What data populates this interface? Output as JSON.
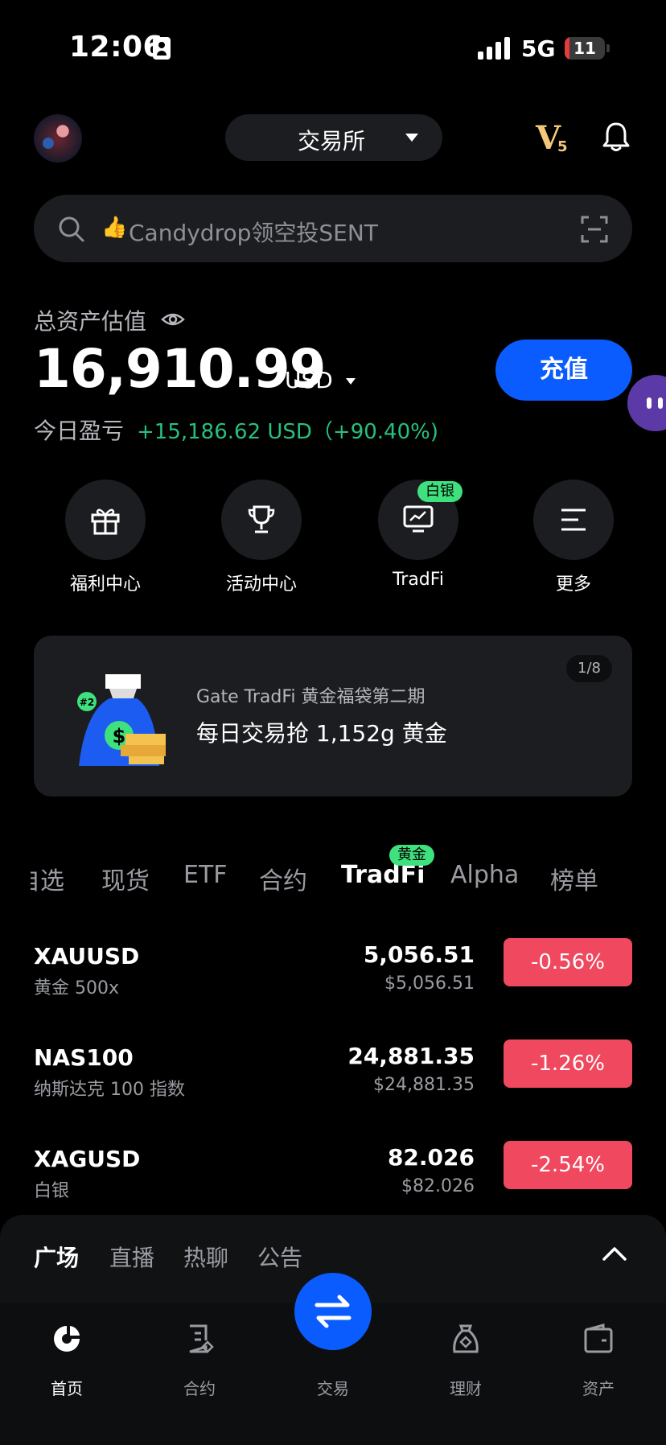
{
  "status_bar": {
    "time": "12:06",
    "network": "5G",
    "battery": "11",
    "battery_level": 0.11
  },
  "header": {
    "exchange_label": "交易所",
    "vip_letter": "V",
    "vip_level": "5"
  },
  "search": {
    "text": "Candydrop领空投SENT"
  },
  "assets": {
    "label": "总资产估值",
    "value": "16,910.99",
    "currency": "USD",
    "pnl_label": "今日盈亏",
    "pnl_value": "+15,186.62 USD（+90.40%)",
    "deposit_label": "充值"
  },
  "quick_actions": [
    {
      "label": "福利中心",
      "icon": "gift-icon"
    },
    {
      "label": "活动中心",
      "icon": "trophy-icon"
    },
    {
      "label": "TradFi",
      "icon": "chart-monitor-icon",
      "badge": "白银"
    },
    {
      "label": "更多",
      "icon": "menu-icon"
    }
  ],
  "banner": {
    "page": "1/8",
    "title": "Gate TradFi 黄金福袋第二期",
    "subtitle": "每日交易抢 1,152g 黄金",
    "art_tag": "#2"
  },
  "market_tabs": {
    "items": [
      "自选",
      "现货",
      "ETF",
      "合约",
      "TradFi",
      "Alpha",
      "榜单"
    ],
    "active": "TradFi",
    "badge": "黄金"
  },
  "market_rows": [
    {
      "symbol": "XAUUSD",
      "name": "黄金 500x",
      "price": "5,056.51",
      "price_usd": "$5,056.51",
      "change": "-0.56%"
    },
    {
      "symbol": "NAS100",
      "name": "纳斯达克 100 指数",
      "price": "24,881.35",
      "price_usd": "$24,881.35",
      "change": "-1.26%"
    },
    {
      "symbol": "XAGUSD",
      "name": "白银",
      "price": "82.026",
      "price_usd": "$82.026",
      "change": "-2.54%"
    }
  ],
  "feed_tabs": {
    "items": [
      "广场",
      "直播",
      "热聊",
      "公告"
    ],
    "active": "广场"
  },
  "bottom_nav": {
    "items": [
      {
        "label": "首页",
        "icon": "home-icon",
        "active": true
      },
      {
        "label": "合约",
        "icon": "contract-icon",
        "active": false
      },
      {
        "label": "交易",
        "icon": "swap-icon",
        "active": false
      },
      {
        "label": "理财",
        "icon": "finance-icon",
        "active": false
      },
      {
        "label": "资产",
        "icon": "wallet-icon",
        "active": false
      }
    ]
  },
  "colors": {
    "accent": "#0a5cff",
    "positive": "#27c07d",
    "negative": "#f0485e",
    "badge_green": "#3fe07e",
    "vip_gold": "#f3c87a"
  }
}
